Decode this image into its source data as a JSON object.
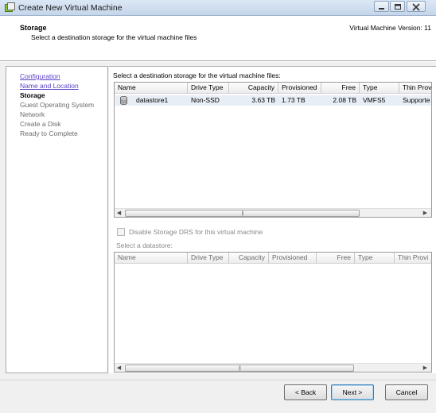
{
  "window": {
    "title": "Create New Virtual Machine"
  },
  "header": {
    "step_title": "Storage",
    "step_subtitle": "Select a destination storage for the virtual machine files",
    "vm_version": "Virtual Machine Version: 11"
  },
  "nav": {
    "items": [
      {
        "label": "Configuration",
        "state": "link"
      },
      {
        "label": "Name and Location",
        "state": "link"
      },
      {
        "label": "Storage",
        "state": "current"
      },
      {
        "label": "Guest Operating System",
        "state": "future"
      },
      {
        "label": "Network",
        "state": "future"
      },
      {
        "label": "Create a Disk",
        "state": "future"
      },
      {
        "label": "Ready to Complete",
        "state": "future"
      }
    ]
  },
  "content": {
    "prompt": "Select a destination storage for the virtual machine files:",
    "columns": [
      "Name",
      "Drive Type",
      "Capacity",
      "Provisioned",
      "Free",
      "Type",
      "Thin Provi"
    ],
    "rows": [
      {
        "name": "datastore1",
        "drive_type": "Non-SSD",
        "capacity": "3.63 TB",
        "provisioned": "1.73 TB",
        "free": "2.08 TB",
        "type": "VMFS5",
        "thin": "Supporte"
      }
    ],
    "disable_drs_label": "Disable Storage DRS for this virtual machine",
    "disable_drs_checked": false,
    "select_datastore_label": "Select a datastore:",
    "columns2": [
      "Name",
      "Drive Type",
      "Capacity",
      "Provisioned",
      "Free",
      "Type",
      "Thin Provi"
    ]
  },
  "footer": {
    "back": "< Back",
    "next": "Next >",
    "cancel": "Cancel"
  },
  "colors": {
    "link": "#5a3ec8",
    "selected_row": "#e8eef6",
    "default_button_border": "#3c7fb1"
  }
}
